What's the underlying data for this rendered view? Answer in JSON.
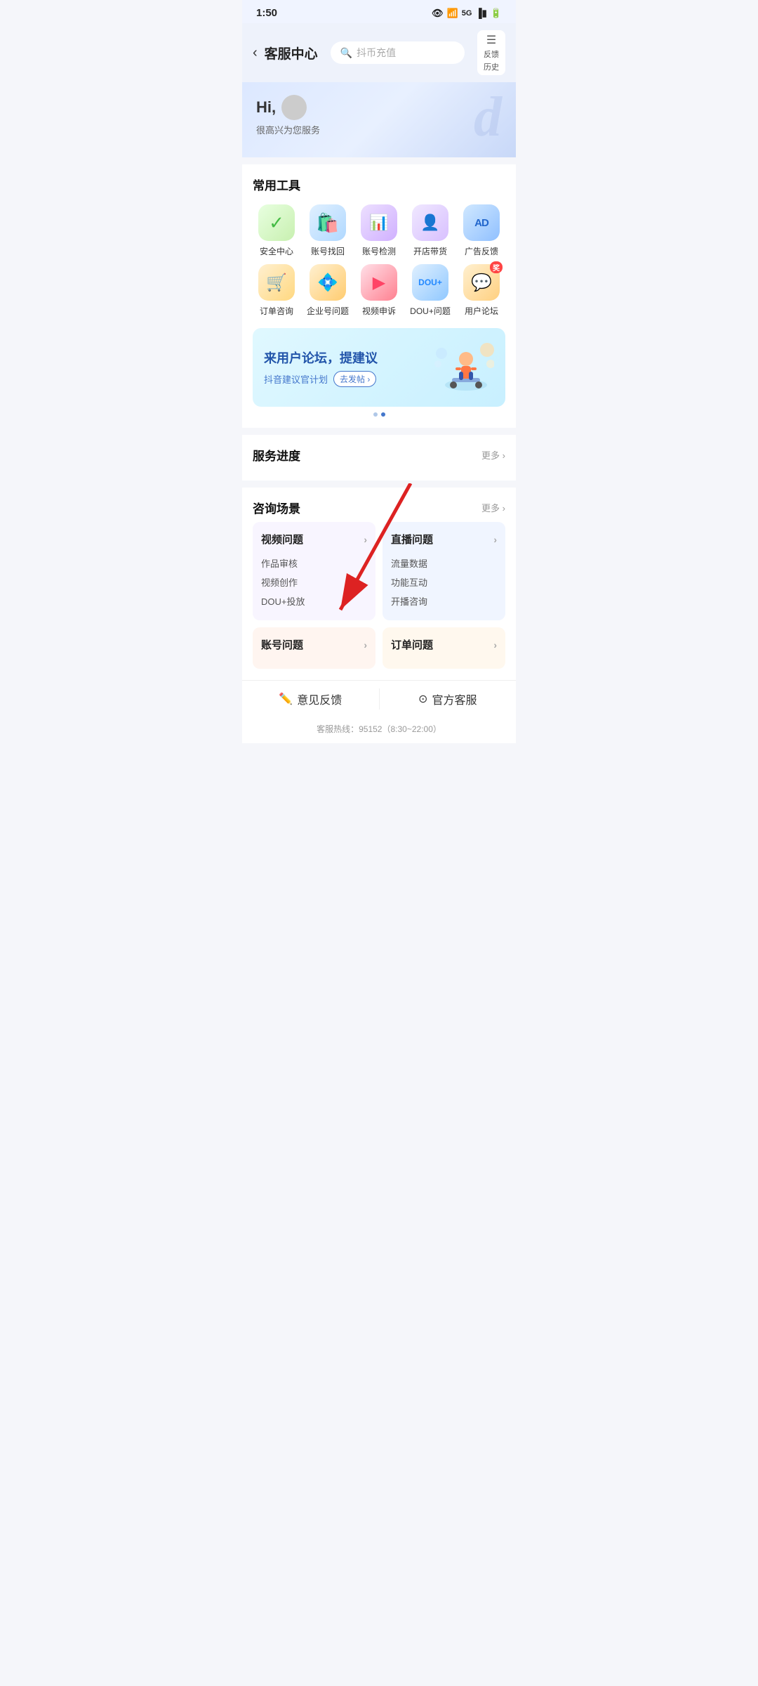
{
  "statusBar": {
    "time": "1:50",
    "icons": "👁 WiFi 5G ▐█▌ 🔋"
  },
  "header": {
    "back": "‹",
    "title": "客服中心",
    "searchPlaceholder": "抖币充值",
    "feedbackLabel1": "反馈",
    "feedbackLabel2": "历史"
  },
  "hero": {
    "greeting": "Hi,",
    "sub": "很高兴为您服务"
  },
  "tools": {
    "sectionTitle": "常用工具",
    "items": [
      {
        "label": "安全中心",
        "iconClass": "icon-security",
        "emoji": "✅"
      },
      {
        "label": "账号找回",
        "iconClass": "icon-account",
        "emoji": "🛍"
      },
      {
        "label": "账号检测",
        "iconClass": "icon-check",
        "emoji": "📊"
      },
      {
        "label": "开店带货",
        "iconClass": "icon-shop",
        "emoji": "👤"
      },
      {
        "label": "广告反馈",
        "iconClass": "icon-ad",
        "emoji": "AD"
      },
      {
        "label": "订单咨询",
        "iconClass": "icon-order",
        "emoji": "🛒"
      },
      {
        "label": "企业号问题",
        "iconClass": "icon-enterprise",
        "emoji": "💠"
      },
      {
        "label": "视频申诉",
        "iconClass": "icon-video",
        "emoji": "▶"
      },
      {
        "label": "DOU+问题",
        "iconClass": "icon-dou",
        "emoji": "DOU+"
      },
      {
        "label": "用户论坛",
        "iconClass": "icon-forum",
        "emoji": "💬",
        "badge": "奖"
      }
    ]
  },
  "banner": {
    "mainText": "来用户论坛，提建议",
    "subText": "抖音建议官计划",
    "btnLabel": "去发帖 ›"
  },
  "serviceProgress": {
    "title": "服务进度",
    "moreLabel": "更多 ›"
  },
  "consultation": {
    "title": "咨询场景",
    "moreLabel": "更多 ›",
    "cards": [
      {
        "title": "视频问题",
        "items": [
          "作品审核",
          "视频创作",
          "DOU+投放"
        ],
        "colorClass": "scene-card"
      },
      {
        "title": "直播问题",
        "items": [
          "流量数据",
          "功能互动",
          "开播咨询"
        ],
        "colorClass": "scene-card scene-card-right"
      },
      {
        "title": "账号问题",
        "items": [],
        "colorClass": "scene-card-bottom"
      },
      {
        "title": "订单问题",
        "items": [],
        "colorClass": "scene-card-bottom scene-card-bottom-right"
      }
    ]
  },
  "bottomNav": {
    "feedback": "意见反馈",
    "service": "官方客服",
    "hotline": "客服热线：95152（8:30~22:00）"
  }
}
